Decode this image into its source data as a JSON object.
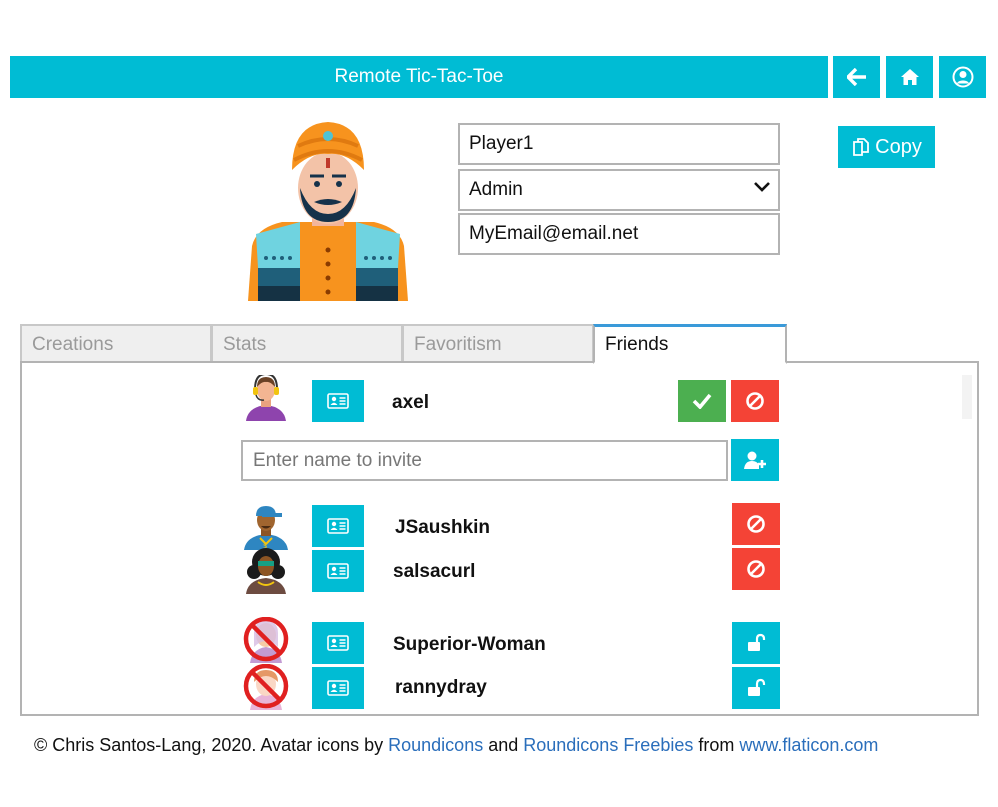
{
  "header": {
    "title": "Remote Tic-Tac-Toe",
    "nav": [
      {
        "icon": "arrow-left-icon"
      },
      {
        "icon": "home-icon"
      },
      {
        "icon": "user-circle-icon"
      }
    ]
  },
  "profile": {
    "avatar": "turban-man-avatar",
    "name": "Player1",
    "role": "Admin",
    "role_options": [
      "Admin"
    ],
    "email": "MyEmail@email.net",
    "copy_label": "Copy"
  },
  "tabs": [
    {
      "label": "Creations",
      "active": false
    },
    {
      "label": "Stats",
      "active": false
    },
    {
      "label": "Favoritism",
      "active": false
    },
    {
      "label": "Friends",
      "active": true
    }
  ],
  "friends": {
    "pending": [
      {
        "name": "axel",
        "avatar": "headset-avatar"
      }
    ],
    "invite_placeholder": "Enter name to invite",
    "accepted": [
      {
        "name": "JSaushkin",
        "avatar": "cap-man-avatar"
      },
      {
        "name": "salsacurl",
        "avatar": "curly-woman-avatar"
      }
    ],
    "blocked": [
      {
        "name": "Superior-Woman",
        "avatar": "blocked-avatar"
      },
      {
        "name": "rannydray",
        "avatar": "blocked-avatar"
      }
    ]
  },
  "footer": {
    "prefix": "© Chris Santos-Lang, 2020. Avatar icons by ",
    "link1": "Roundicons",
    "and": " and ",
    "link2": "Roundicons Freebies",
    "from": " from ",
    "link3": "www.flaticon.com"
  },
  "colors": {
    "accent": "#00bcd4",
    "accept": "#4caf50",
    "block": "#f44336",
    "link": "#2a6ebb"
  }
}
